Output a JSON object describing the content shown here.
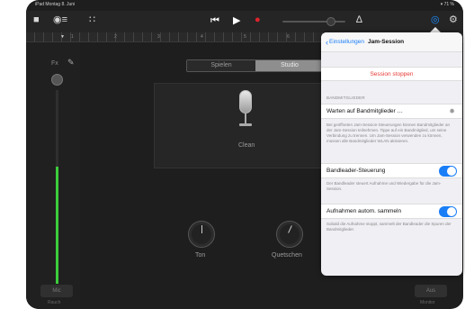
{
  "status": {
    "left": "iPad  Montag 8. Juni",
    "right": "▾ 71 %"
  },
  "toolbar": {
    "icons": [
      "document-icon",
      "mixer-icon",
      "list-icon",
      "eq-icon",
      "rewind-icon",
      "play-icon",
      "record-icon",
      "metronome-icon",
      "jam-session-icon",
      "settings-icon"
    ],
    "glyphs": {
      "document": "■",
      "mixer": "◉≡",
      "tracks": "∷",
      "rewind": "⏮",
      "play": "▶",
      "record": "●",
      "metronome": "∆",
      "jam": "◎",
      "settings": "⚙"
    },
    "colors": {
      "record": "#e0242b",
      "active": "#1a8cff"
    }
  },
  "ruler": {
    "marks": [
      "1",
      "2",
      "3",
      "4",
      "5",
      "6",
      "7",
      "8"
    ],
    "playhead": "▼"
  },
  "track": {
    "fx": "Fx",
    "brush_glyph": "✎",
    "meter_color": "#3ccc3c"
  },
  "mode_switch": {
    "options": [
      "Spielen",
      "Studio"
    ],
    "selected": "Studio"
  },
  "amp": {
    "preset": "Clean"
  },
  "knobs": [
    {
      "label": "Ton"
    },
    {
      "label": "Quetschen"
    }
  ],
  "corners": {
    "left_btn": "Mic",
    "left_sub": "Rauch",
    "right_btn": "Aus",
    "right_sub": "Monitor"
  },
  "popover": {
    "back_label": "Einstellungen",
    "title": "Jam-Session",
    "stop_button": "Session stoppen",
    "section_header": "BANDMITGLIEDER",
    "waiting_label": "Warten auf Bandmitglieder …",
    "waiting_desc": "Bei geöffneten Jam-Session-Steuerungen können Bandmitglieder an der Jam-Session teilnehmen. Tippe auf ein Bandmitglied, um seine Verbindung zu trennen. Um Jam-Session verwenden zu können, müssen alle Bandmitglieder WLAN aktivieren.",
    "leader_label": "Bandleader-Steuerung",
    "leader_on": true,
    "leader_desc": "Der Bandleader steuert Aufnahme und Wiedergabe für die Jam-Session.",
    "collect_label": "Aufnahmen autom. sammeln",
    "collect_on": true,
    "collect_desc": "Sobald die Aufnahme stoppt, sammelt der Bandleader die Spuren der Bandmitglieder.",
    "accent": "#1a7ef7",
    "stop_color": "#e53935"
  }
}
